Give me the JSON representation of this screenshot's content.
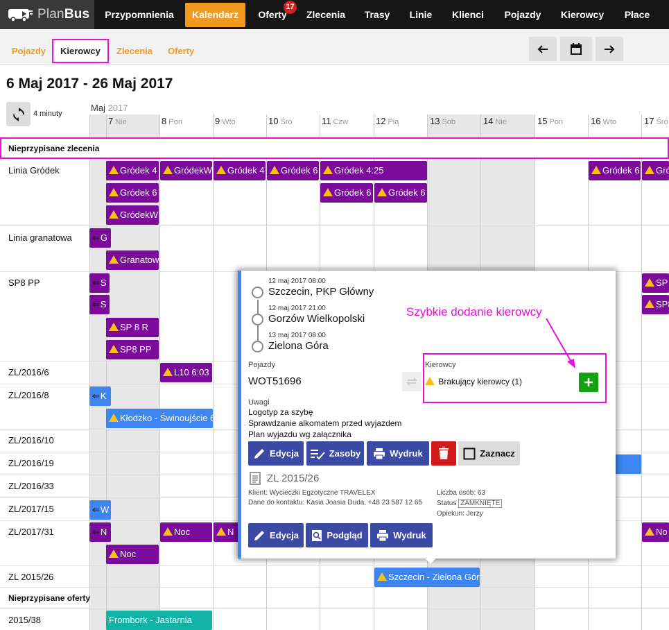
{
  "brand": {
    "name_light": "Plan",
    "name_bold": "Bus"
  },
  "nav": [
    {
      "label": "Przypomnienia"
    },
    {
      "label": "Kalendarz"
    },
    {
      "label": "Oferty",
      "badge": "17"
    },
    {
      "label": "Zlecenia"
    },
    {
      "label": "Trasy"
    },
    {
      "label": "Linie"
    },
    {
      "label": "Klienci"
    },
    {
      "label": "Pojazdy"
    },
    {
      "label": "Kierowcy"
    },
    {
      "label": "Płace"
    }
  ],
  "subtabs": [
    "Pojazdy",
    "Kierowcy",
    "Zlecenia",
    "Oferty"
  ],
  "title": "6 Maj 2017 - 26 Maj 2017",
  "refresh_label": "4 minuty",
  "month": {
    "name": "Maj",
    "year": "2017"
  },
  "days": [
    {
      "num": "7",
      "name": "Nie"
    },
    {
      "num": "8",
      "name": "Pon"
    },
    {
      "num": "9",
      "name": "Wto"
    },
    {
      "num": "10",
      "name": "Śro"
    },
    {
      "num": "11",
      "name": "Czw"
    },
    {
      "num": "12",
      "name": "Pią"
    },
    {
      "num": "13",
      "name": "Sob"
    },
    {
      "num": "14",
      "name": "Nie"
    },
    {
      "num": "15",
      "name": "Pon"
    },
    {
      "num": "16",
      "name": "Wto"
    },
    {
      "num": "17",
      "name": "Śro"
    }
  ],
  "sections": {
    "unassigned_orders": "Nieprzypisane zlecenia",
    "unassigned_offers": "Nieprzypisane oferty"
  },
  "rows": [
    "Linia Gródek",
    "Linia granatowa",
    "SP8 PP",
    "ZL/2016/6",
    "ZL/2016/8",
    "ZL/2016/10",
    "ZL/2016/19",
    "ZL/2016/33",
    "ZL/2017/15",
    "ZL/2017/31",
    "ZL 2015/26",
    "2015/38"
  ],
  "events": [
    {
      "text": "Gródek 4"
    },
    {
      "text": "GródekW"
    },
    {
      "text": "Gródek 4"
    },
    {
      "text": "Gródek 6"
    },
    {
      "text": "Gródek 4:25"
    },
    {
      "text": "Gródek 6"
    },
    {
      "text": "Gródek"
    },
    {
      "text": "Gródek 6"
    },
    {
      "text": "Gródek 6"
    },
    {
      "text": "Gródek 6"
    },
    {
      "text": "GródekW"
    },
    {
      "text": "G"
    },
    {
      "text": "Granatow"
    },
    {
      "text": "S"
    },
    {
      "text": "SP"
    },
    {
      "text": "S"
    },
    {
      "text": "SP8"
    },
    {
      "text": "SP 8 R"
    },
    {
      "text": "SP8 PP"
    },
    {
      "text": "L10 6:03"
    },
    {
      "text": "K"
    },
    {
      "text": "Kłodzko - Świnoujście 6"
    },
    {
      "text": "W"
    },
    {
      "text": "N"
    },
    {
      "text": "Noc"
    },
    {
      "text": "N"
    },
    {
      "text": "No"
    },
    {
      "text": "Noc"
    },
    {
      "text": "Szczecin - Zielona Góra"
    },
    {
      "text": "Frombork - Jastarnia"
    }
  ],
  "popup": {
    "stops": [
      {
        "time": "12 maj 2017 08:00",
        "name": "Szczecin, PKP Główny"
      },
      {
        "time": "12 maj 2017 21:00",
        "name": "Gorzów Wielkopolski"
      },
      {
        "time": "13 maj 2017 08:00",
        "name": "Zielona Góra"
      }
    ],
    "vehicles_label": "Pojazdy",
    "vehicle": "WOT51696",
    "drivers_label": "Kierowcy",
    "missing_driver": "Brakujący kierowcy (1)",
    "notes_label": "Uwagi",
    "notes": [
      "Logotyp za szybę",
      "Sprawdzanie alkomatem przed wyjazdem",
      "Plan wyjazdu wg załącznika"
    ],
    "buttons1": {
      "edit": "Edycja",
      "resources": "Zasoby",
      "print": "Wydruk",
      "mark": "Zaznacz"
    },
    "order_title": "ZL 2015/26",
    "client": "Klient: Wycieczki Egzotyczne TRAVELEX",
    "contact": "Dane do kontaktu: Kasia Joasia Duda, +48 23 587 12 65",
    "people": "Liczba osób: 63",
    "status_label": "Status",
    "status_value": "ZAMKNIĘTE",
    "guardian": "Opiekun: Jerzy",
    "buttons2": {
      "edit": "Edycja",
      "preview": "Podgląd",
      "print": "Wydruk"
    }
  },
  "annotation": "Szybkie dodanie kierowcy",
  "colors": {
    "accent": "#f39a1e",
    "highlight": "#e80fdf",
    "purple": "#7a0b9b",
    "blue": "#3d86f2",
    "teal": "#12b3a6",
    "indigo": "#3b4aa3",
    "green": "#14a30e"
  }
}
